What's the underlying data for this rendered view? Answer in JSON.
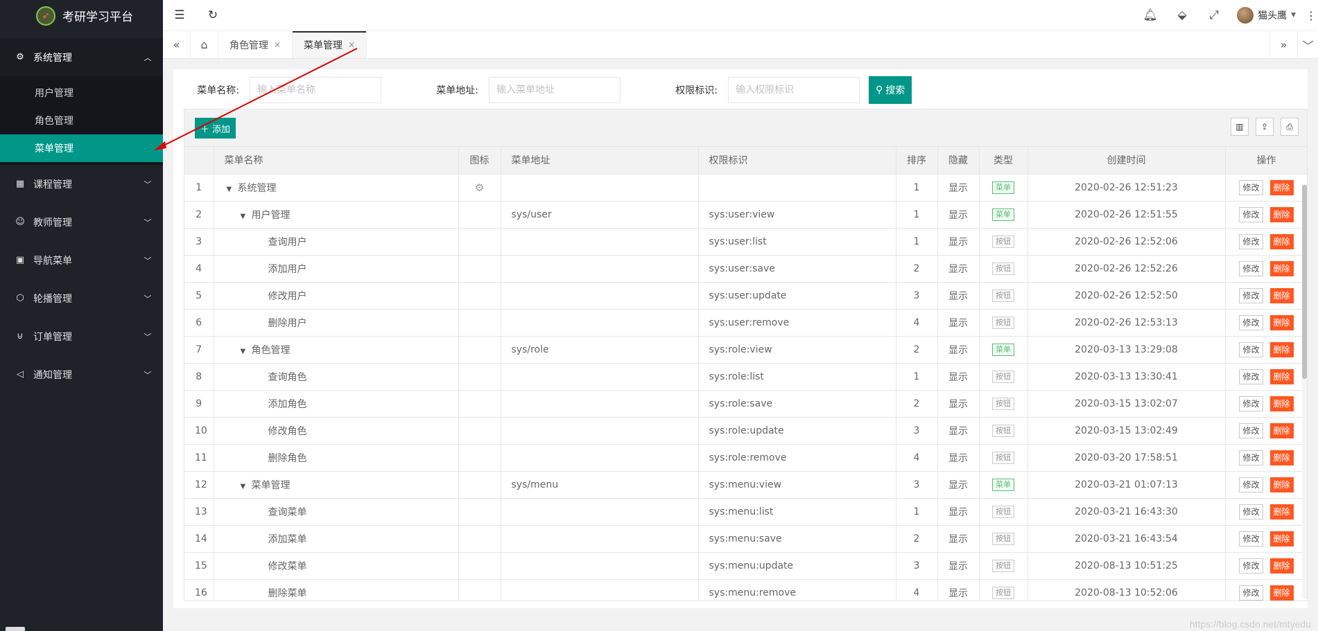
{
  "app": {
    "title": "考研学习平台"
  },
  "sidebar": {
    "groups": [
      {
        "label": "系统管理",
        "icon": "gear-icon",
        "open": true,
        "items": [
          {
            "label": "用户管理"
          },
          {
            "label": "角色管理"
          },
          {
            "label": "菜单管理",
            "active": true
          }
        ]
      },
      {
        "label": "课程管理",
        "icon": "grid-icon"
      },
      {
        "label": "教师管理",
        "icon": "user-icon"
      },
      {
        "label": "导航菜单",
        "icon": "apps-icon"
      },
      {
        "label": "轮播管理",
        "icon": "cube-icon"
      },
      {
        "label": "订单管理",
        "icon": "cart-icon"
      },
      {
        "label": "通知管理",
        "icon": "speaker-icon"
      }
    ]
  },
  "header": {
    "user_name": "猫头鹰"
  },
  "tabs": [
    {
      "label": "角色管理",
      "active": false
    },
    {
      "label": "菜单管理",
      "active": true
    }
  ],
  "search": {
    "name_label": "菜单名称:",
    "name_placeholder": "输入菜单名称",
    "url_label": "菜单地址:",
    "url_placeholder": "输入菜单地址",
    "perm_label": "权限标识:",
    "perm_placeholder": "输入权限标识",
    "button": "搜索"
  },
  "toolbar": {
    "add_label": "添加"
  },
  "table": {
    "columns": [
      "菜单名称",
      "图标",
      "菜单地址",
      "权限标识",
      "排序",
      "隐藏",
      "类型",
      "创建时间",
      "操作"
    ],
    "rows": [
      {
        "no": "1",
        "name": "系统管理",
        "level": 0,
        "caret": true,
        "icon": "gear",
        "url": "",
        "perm": "",
        "sort": "1",
        "hidden": "显示",
        "type": "菜单",
        "time": "2020-02-26 12:51:23"
      },
      {
        "no": "2",
        "name": "用户管理",
        "level": 1,
        "caret": true,
        "icon": "",
        "url": "sys/user",
        "perm": "sys:user:view",
        "sort": "1",
        "hidden": "显示",
        "type": "菜单",
        "time": "2020-02-26 12:51:55"
      },
      {
        "no": "3",
        "name": "查询用户",
        "level": 2,
        "caret": false,
        "icon": "",
        "url": "",
        "perm": "sys:user:list",
        "sort": "1",
        "hidden": "显示",
        "type": "按钮",
        "time": "2020-02-26 12:52:06"
      },
      {
        "no": "4",
        "name": "添加用户",
        "level": 2,
        "caret": false,
        "icon": "",
        "url": "",
        "perm": "sys:user:save",
        "sort": "2",
        "hidden": "显示",
        "type": "按钮",
        "time": "2020-02-26 12:52:26"
      },
      {
        "no": "5",
        "name": "修改用户",
        "level": 2,
        "caret": false,
        "icon": "",
        "url": "",
        "perm": "sys:user:update",
        "sort": "3",
        "hidden": "显示",
        "type": "按钮",
        "time": "2020-02-26 12:52:50"
      },
      {
        "no": "6",
        "name": "删除用户",
        "level": 2,
        "caret": false,
        "icon": "",
        "url": "",
        "perm": "sys:user:remove",
        "sort": "4",
        "hidden": "显示",
        "type": "按钮",
        "time": "2020-02-26 12:53:13"
      },
      {
        "no": "7",
        "name": "角色管理",
        "level": 1,
        "caret": true,
        "icon": "",
        "url": "sys/role",
        "perm": "sys:role:view",
        "sort": "2",
        "hidden": "显示",
        "type": "菜单",
        "time": "2020-03-13 13:29:08"
      },
      {
        "no": "8",
        "name": "查询角色",
        "level": 2,
        "caret": false,
        "icon": "",
        "url": "",
        "perm": "sys:role:list",
        "sort": "1",
        "hidden": "显示",
        "type": "按钮",
        "time": "2020-03-13 13:30:41"
      },
      {
        "no": "9",
        "name": "添加角色",
        "level": 2,
        "caret": false,
        "icon": "",
        "url": "",
        "perm": "sys:role:save",
        "sort": "2",
        "hidden": "显示",
        "type": "按钮",
        "time": "2020-03-15 13:02:07"
      },
      {
        "no": "10",
        "name": "修改角色",
        "level": 2,
        "caret": false,
        "icon": "",
        "url": "",
        "perm": "sys:role:update",
        "sort": "3",
        "hidden": "显示",
        "type": "按钮",
        "time": "2020-03-15 13:02:49"
      },
      {
        "no": "11",
        "name": "删除角色",
        "level": 2,
        "caret": false,
        "icon": "",
        "url": "",
        "perm": "sys:role:remove",
        "sort": "4",
        "hidden": "显示",
        "type": "按钮",
        "time": "2020-03-20 17:58:51"
      },
      {
        "no": "12",
        "name": "菜单管理",
        "level": 1,
        "caret": true,
        "icon": "",
        "url": "sys/menu",
        "perm": "sys:menu:view",
        "sort": "3",
        "hidden": "显示",
        "type": "菜单",
        "time": "2020-03-21 01:07:13"
      },
      {
        "no": "13",
        "name": "查询菜单",
        "level": 2,
        "caret": false,
        "icon": "",
        "url": "",
        "perm": "sys:menu:list",
        "sort": "1",
        "hidden": "显示",
        "type": "按钮",
        "time": "2020-03-21 16:43:30"
      },
      {
        "no": "14",
        "name": "添加菜单",
        "level": 2,
        "caret": false,
        "icon": "",
        "url": "",
        "perm": "sys:menu:save",
        "sort": "2",
        "hidden": "显示",
        "type": "按钮",
        "time": "2020-03-21 16:43:54"
      },
      {
        "no": "15",
        "name": "修改菜单",
        "level": 2,
        "caret": false,
        "icon": "",
        "url": "",
        "perm": "sys:menu:update",
        "sort": "3",
        "hidden": "显示",
        "type": "按钮",
        "time": "2020-08-13 10:51:25"
      },
      {
        "no": "16",
        "name": "删除菜单",
        "level": 2,
        "caret": false,
        "icon": "",
        "url": "",
        "perm": "sys:menu:remove",
        "sort": "4",
        "hidden": "显示",
        "type": "按钮",
        "time": "2020-08-13 10:52:06"
      }
    ],
    "edit_label": "修改",
    "delete_label": "删除"
  },
  "watermark": "https://blog.csdn.net/mtyedu",
  "colors": {
    "accent": "#009688",
    "sidebar_bg": "#20222a",
    "danger": "#ff5722",
    "arrow": "#e00000"
  }
}
